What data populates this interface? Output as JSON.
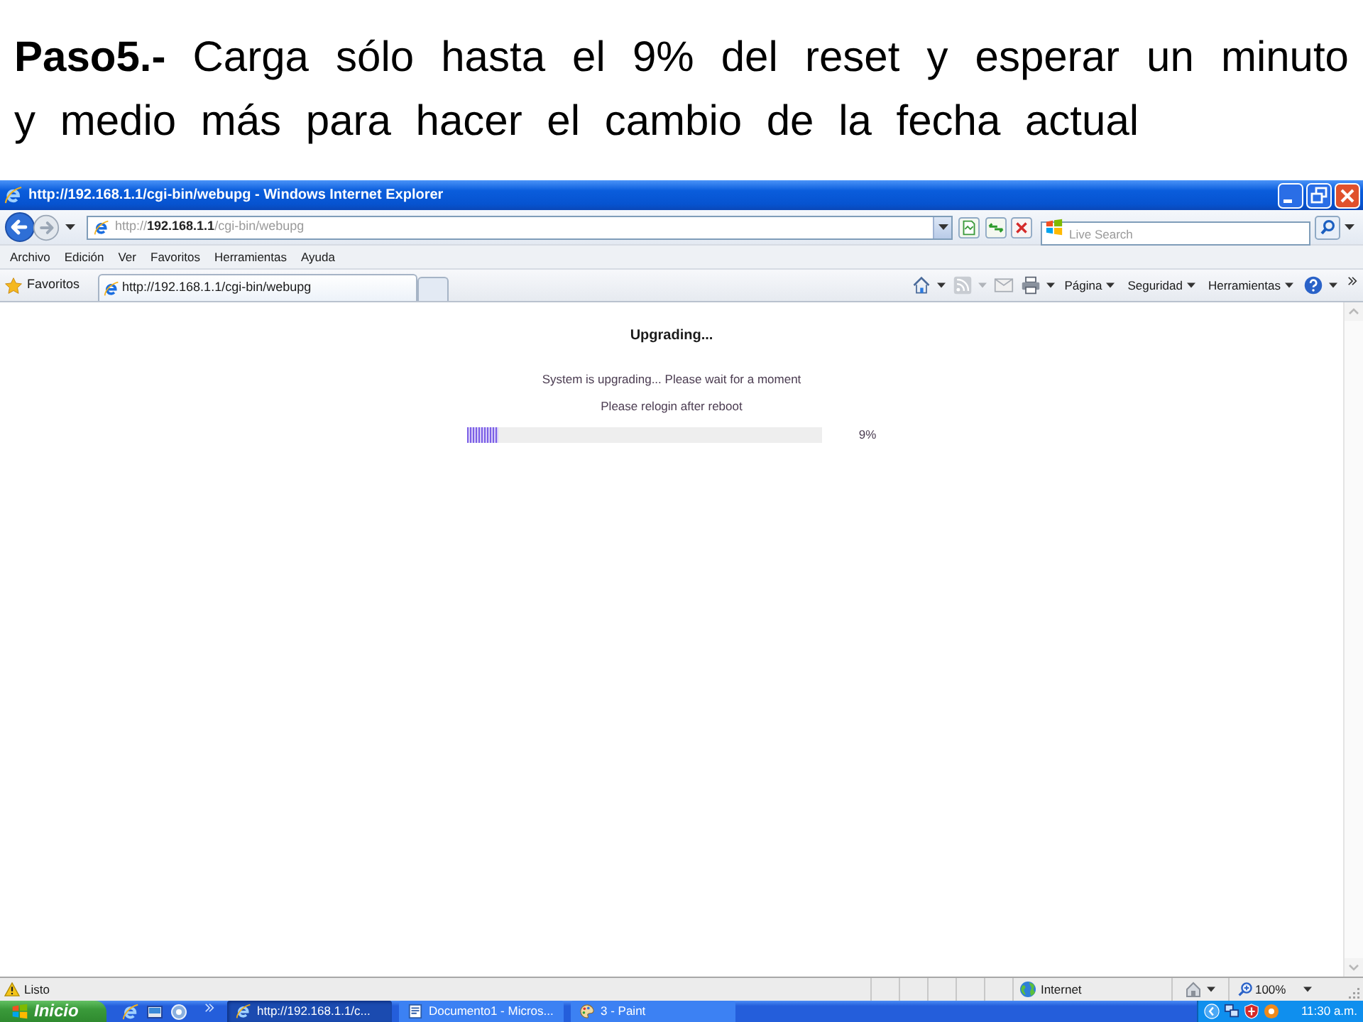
{
  "slide": {
    "text": "**Paso5.-** Carga sólo hasta el 9% del reset y esperar un minuto y medio más para hacer el cambio de la fecha actual"
  },
  "window": {
    "title": "http://192.168.1.1/cgi-bin/webupg - Windows Internet Explorer"
  },
  "address_bar": {
    "value": "http://**192.168.1.1**/cgi-bin/webupg"
  },
  "search": {
    "placeholder": "Live Search"
  },
  "menu": [
    "Archivo",
    "Edición",
    "Ver",
    "Favoritos",
    "Herramientas",
    "Ayuda"
  ],
  "favorites_bar": {
    "favorites": "Favoritos",
    "tabs": [
      {
        "label": "http://192.168.1.1/cgi-bin/webupg",
        "selected": true
      }
    ]
  },
  "command_bar": [
    "Página",
    "Seguridad",
    "Herramientas"
  ],
  "page": {
    "heading": "Upgrading...",
    "lines": [
      "System is upgrading... Please wait for a moment",
      "Please relogin after reboot"
    ],
    "progress": {
      "level": 0.09,
      "reading": "9%"
    }
  },
  "status_bar": {
    "text": "Listo",
    "zone": "Internet",
    "zoom": "100%"
  },
  "taskbar": {
    "start": "Inicio",
    "tasks": [
      {
        "label": "http://192.168.1.1/c...",
        "selected": true
      },
      {
        "label": "Documento1 - Micros...",
        "selected": false
      },
      {
        "label": "3 - Paint",
        "selected": false
      }
    ],
    "clock": "11:30 a.m."
  }
}
